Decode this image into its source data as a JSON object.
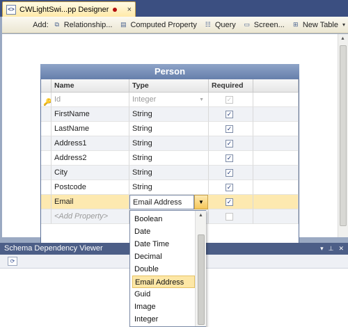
{
  "document_tab": {
    "title": "CWLightSwi...pp Designer",
    "close": "×"
  },
  "toolbar": {
    "add_label": "Add:",
    "buttons": [
      {
        "label": "Relationship...",
        "icon": "relationship-icon"
      },
      {
        "label": "Computed Property",
        "icon": "computed-property-icon"
      },
      {
        "label": "Query",
        "icon": "query-icon"
      },
      {
        "label": "Screen...",
        "icon": "screen-icon"
      },
      {
        "label": "New Table",
        "icon": "new-table-icon"
      }
    ]
  },
  "entity": {
    "title": "Person",
    "columns": {
      "name": "Name",
      "type": "Type",
      "required": "Required"
    },
    "properties": [
      {
        "name": "Id",
        "type": "Integer",
        "required": true,
        "key": true
      },
      {
        "name": "FirstName",
        "type": "String",
        "required": true
      },
      {
        "name": "LastName",
        "type": "String",
        "required": true
      },
      {
        "name": "Address1",
        "type": "String",
        "required": true
      },
      {
        "name": "Address2",
        "type": "String",
        "required": true
      },
      {
        "name": "City",
        "type": "String",
        "required": true
      },
      {
        "name": "Postcode",
        "type": "String",
        "required": true
      },
      {
        "name": "Email",
        "type": "Email Address",
        "required": true,
        "selected": true
      }
    ],
    "add_property_placeholder": "<Add Property>"
  },
  "type_dropdown": {
    "options": [
      "Boolean",
      "Date",
      "Date Time",
      "Decimal",
      "Double",
      "Email Address",
      "Guid",
      "Image",
      "Integer"
    ],
    "highlighted": "Email Address"
  },
  "schema_viewer": {
    "title": "Schema Dependency Viewer"
  },
  "colors": {
    "accent": "#f6c75a",
    "entity_header": "#667fab",
    "pane_header": "#4c5e87"
  }
}
